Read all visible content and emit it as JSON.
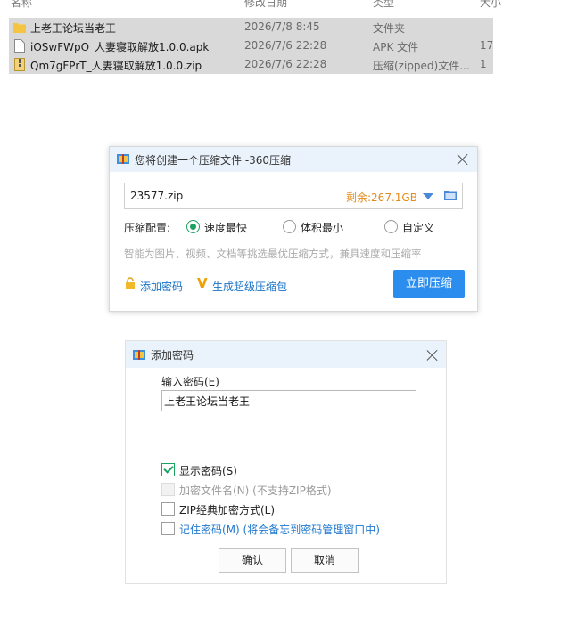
{
  "explorer": {
    "columns": [
      "名称",
      "修改日期",
      "类型",
      "大小"
    ],
    "rows": [
      {
        "name": "上老王论坛当老王",
        "date": "2026/7/8 8:45",
        "type": "文件夹",
        "size": "",
        "icon": "folder-icon"
      },
      {
        "name": "iOSwFWpO_人妻寝取解放1.0.0.apk",
        "date": "2026/7/6 22:28",
        "type": "APK 文件",
        "size": "17",
        "icon": "file-icon"
      },
      {
        "name": "Qm7gFPrT_人妻寝取解放1.0.0.zip",
        "date": "2026/7/6 22:28",
        "type": "压缩(zipped)文件...",
        "size": "1",
        "icon": "zip-file-icon"
      }
    ]
  },
  "compress_dialog": {
    "title": "您将创建一个压缩文件 -360压缩",
    "filename": "23577.zip",
    "free_space": "剩余:267.1GB",
    "config_label": "压缩配置:",
    "options": [
      "速度最快",
      "体积最小",
      "自定义"
    ],
    "selected_option": "速度最快",
    "hint": "智能为图片、视频、文档等挑选最优压缩方式，兼具速度和压缩率",
    "add_password": "添加密码",
    "super_pack": "生成超级压缩包",
    "compress_now": "立即压缩",
    "colors": {
      "accent": "#2b8eee",
      "space": "#e48a1b",
      "radio": "#1aa260"
    }
  },
  "password_dialog": {
    "title": "添加密码",
    "input_label": "输入密码(E)",
    "password_value": "上老王论坛当老王",
    "show_password": "显示密码(S)",
    "show_password_checked": true,
    "encrypt_filenames": "加密文件名(N) (不支持ZIP格式)",
    "zip_classic": "ZIP经典加密方式(L)",
    "remember_password": "记住密码(M) (将会备忘到密码管理窗口中)",
    "ok": "确认",
    "cancel": "取消"
  }
}
